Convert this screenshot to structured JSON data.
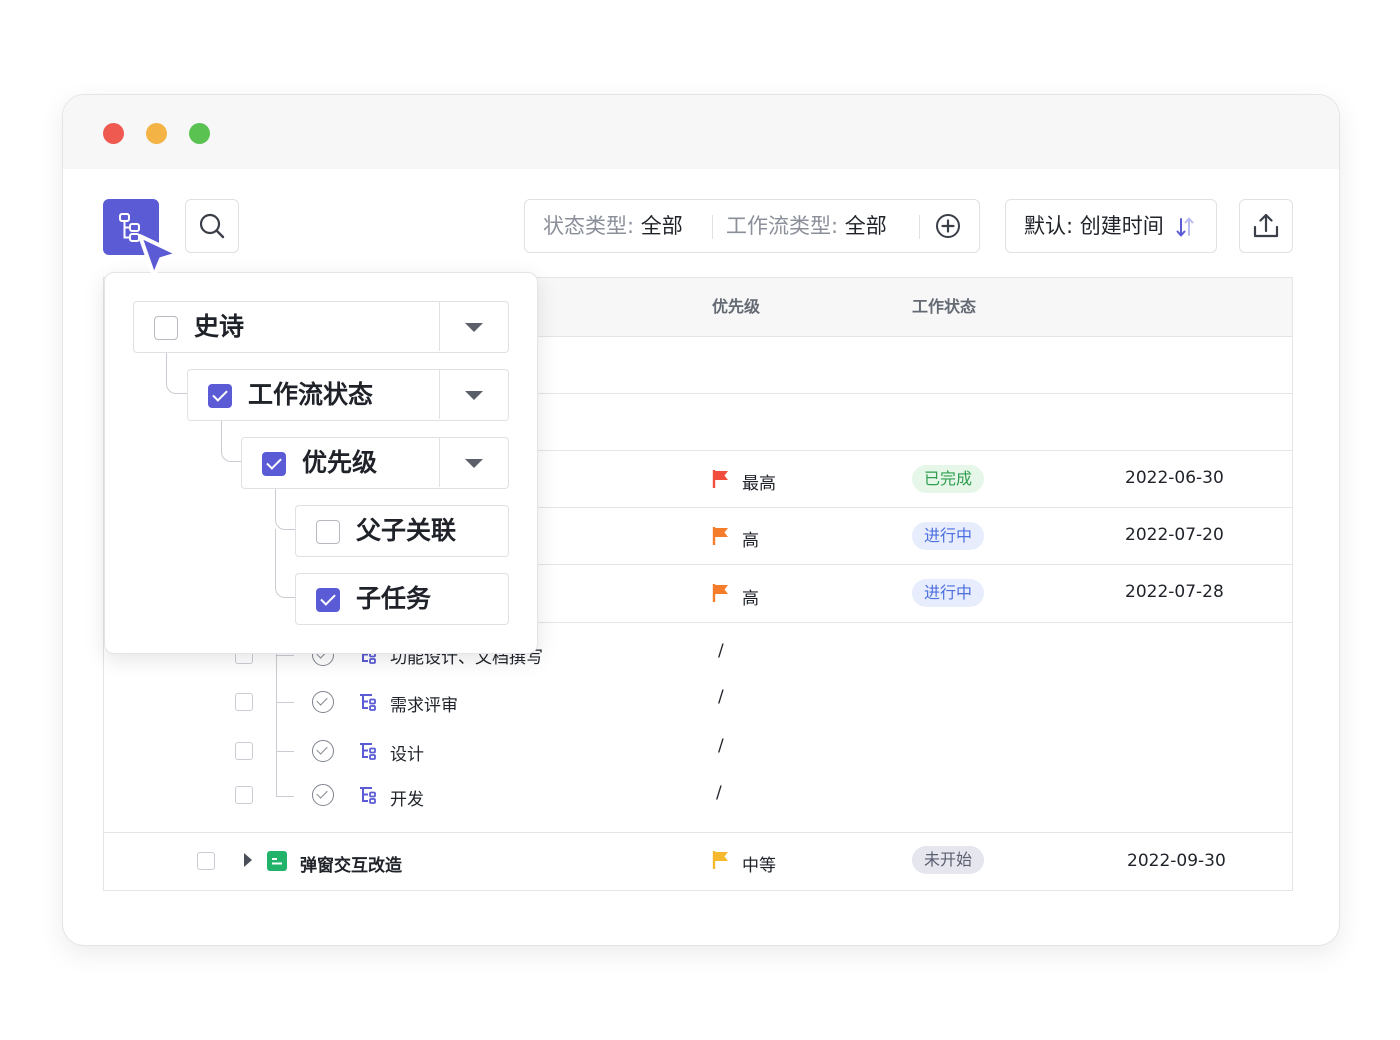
{
  "window": {
    "controls": [
      "close",
      "minimize",
      "maximize"
    ]
  },
  "toolbar": {
    "tree_button_icon": "tree-hierarchy-icon",
    "search_icon": "search-icon",
    "filter": {
      "status_label": "状态类型:",
      "status_value": "全部",
      "workflow_label": "工作流类型:",
      "workflow_value": "全部",
      "add_icon": "plus-circle-icon"
    },
    "sort": {
      "label": "默认:",
      "value": "创建时间",
      "icon": "sort-arrows-icon"
    },
    "export_icon": "export-icon"
  },
  "table": {
    "headers": {
      "priority": "优先级",
      "status": "工作状态"
    },
    "rows": [
      {
        "priority": "最高",
        "priority_color": "#f24e3d",
        "status": "已完成",
        "status_type": "done",
        "date": "2022-06-30"
      },
      {
        "priority": "高",
        "priority_color": "#f57c2a",
        "status": "进行中",
        "status_type": "doing",
        "date": "2022-07-20"
      },
      {
        "priority": "高",
        "priority_color": "#f57c2a",
        "status": "进行中",
        "status_type": "doing",
        "date": "2022-07-28"
      }
    ],
    "subtasks": [
      {
        "title": "功能设计、文档撰写",
        "priority": "/"
      },
      {
        "title": "需求评审",
        "priority": "/"
      },
      {
        "title": "设计",
        "priority": "/"
      },
      {
        "title": "开发",
        "priority": "/"
      }
    ],
    "last_row": {
      "title": "弹窗交互改造",
      "priority": "中等",
      "priority_color": "#f5b82e",
      "status": "未开始",
      "status_type": "todo",
      "date": "2022-09-30"
    }
  },
  "popup": {
    "levels": [
      {
        "label": "史诗",
        "checked": false,
        "has_dropdown": true
      },
      {
        "label": "工作流状态",
        "checked": true,
        "has_dropdown": true
      },
      {
        "label": "优先级",
        "checked": true,
        "has_dropdown": true
      },
      {
        "label": "父子关联",
        "checked": false,
        "has_dropdown": false
      },
      {
        "label": "子任务",
        "checked": true,
        "has_dropdown": false
      }
    ]
  },
  "colors": {
    "accent": "#5b5bd6",
    "green_icon": "#21b36a"
  }
}
